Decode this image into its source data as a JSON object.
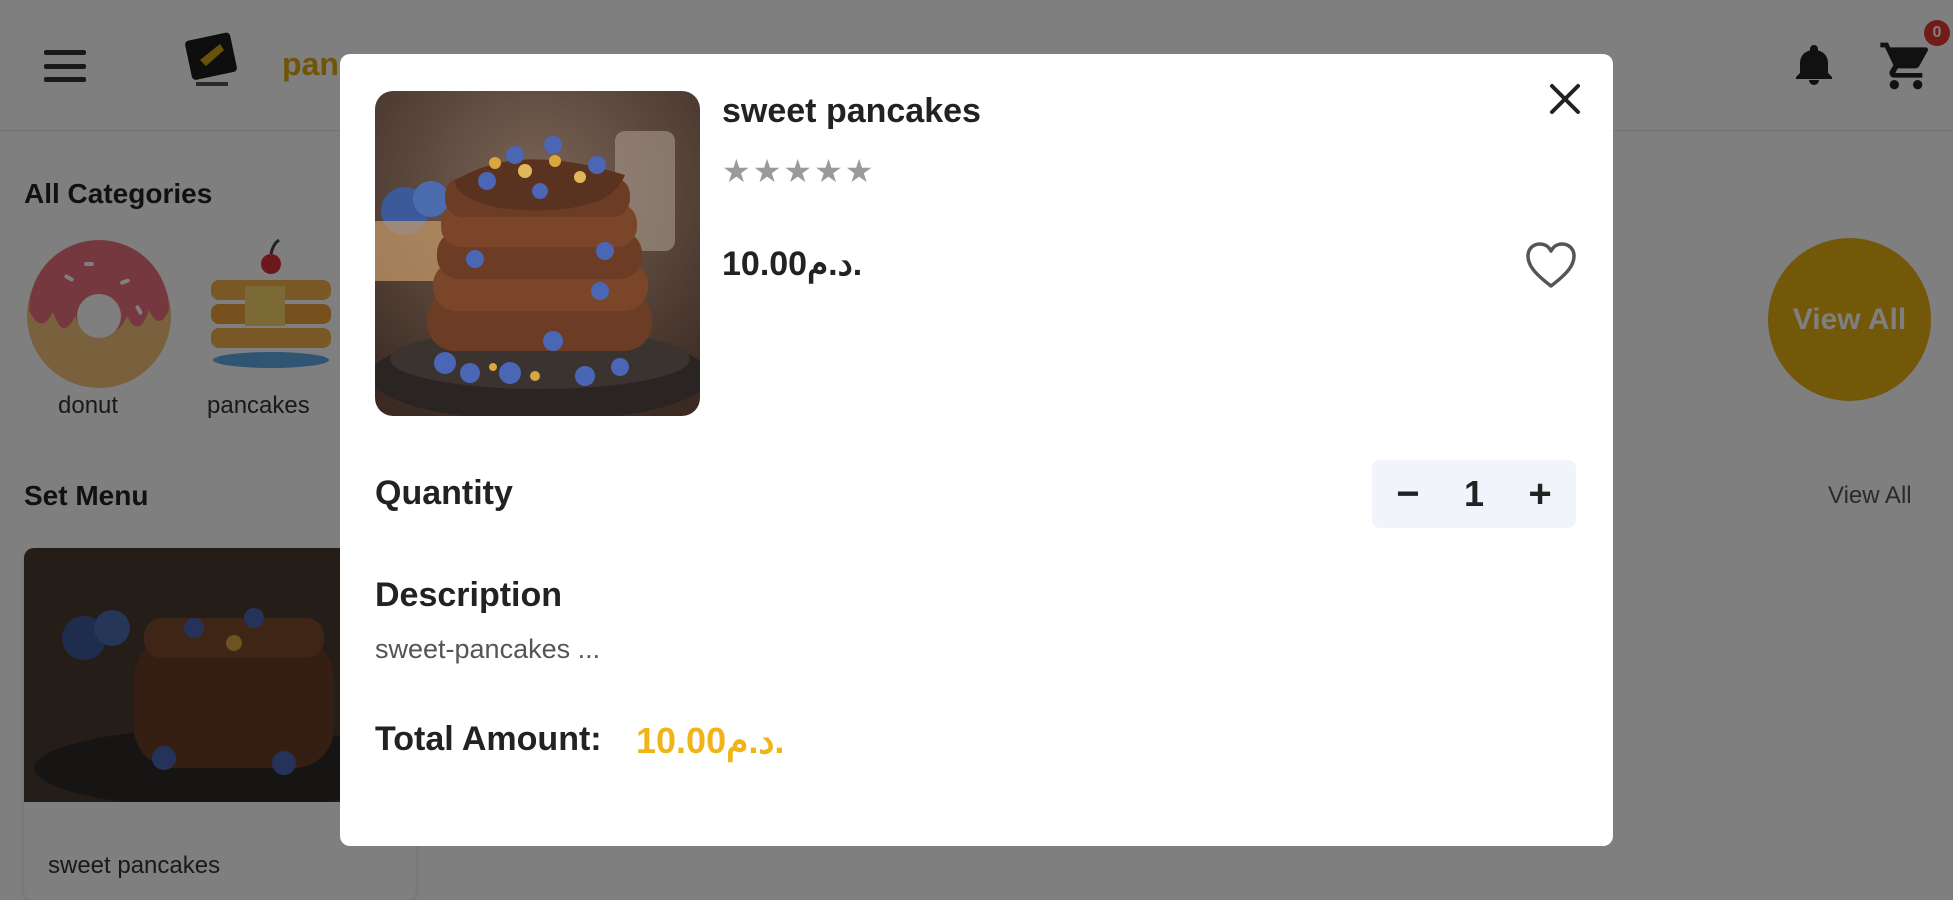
{
  "header": {
    "brand": "pan",
    "cart_count": "0"
  },
  "categories": {
    "title": "All Categories",
    "items": [
      {
        "label": "donut",
        "icon": "donut-icon"
      },
      {
        "label": "pancakes",
        "icon": "pancake-icon"
      }
    ],
    "view_all": "View All"
  },
  "set_menu": {
    "title": "Set Menu",
    "view_all": "View All",
    "items": [
      {
        "name": "sweet pancakes"
      }
    ]
  },
  "modal": {
    "product_name": "sweet pancakes",
    "rating_text": "★★★★★",
    "rating_value": 0,
    "rating_max": 5,
    "price": "10.00د.م.",
    "quantity_label": "Quantity",
    "quantity": "1",
    "minus_label": "−",
    "plus_label": "+",
    "description_label": "Description",
    "description": "sweet-pancakes ...",
    "total_label": "Total Amount:",
    "total_value": "10.00د.م."
  },
  "colors": {
    "accent": "#f0b419",
    "brand": "#e3a80f",
    "badge": "#e53935",
    "stepper_bg": "#f1f4fa"
  }
}
